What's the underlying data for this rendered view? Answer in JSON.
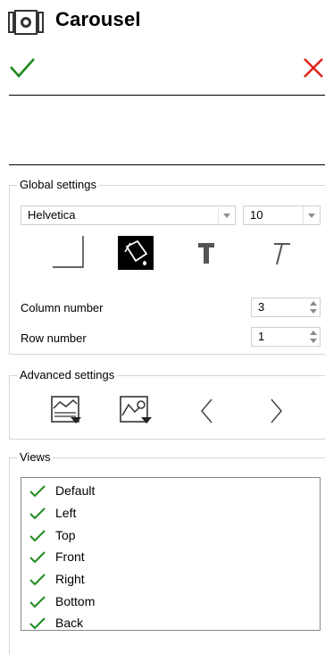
{
  "header": {
    "title": "Carousel",
    "icon": "carousel-icon",
    "ok_icon": "check-icon",
    "cancel_icon": "close-icon",
    "colors": {
      "ok": "#1e8a1e",
      "cancel": "#e0261b"
    }
  },
  "global_settings": {
    "label": "Global settings",
    "font": "Helvetica",
    "font_size": "10",
    "tools": [
      "border-corner-icon",
      "fill-bucket-icon",
      "bold-text-icon",
      "italic-text-icon"
    ],
    "column_label": "Column number",
    "column_value": "3",
    "row_label": "Row number",
    "row_value": "1"
  },
  "advanced_settings": {
    "label": "Advanced settings",
    "tools": [
      "image-background-icon",
      "image-settings-icon",
      "previous-arrow-icon",
      "next-arrow-icon"
    ]
  },
  "views": {
    "label": "Views",
    "check_icon": "check-icon",
    "check_color": "#1e8a1e",
    "items": [
      "Default",
      "Left",
      "Top",
      "Front",
      "Right",
      "Bottom",
      "Back"
    ]
  }
}
